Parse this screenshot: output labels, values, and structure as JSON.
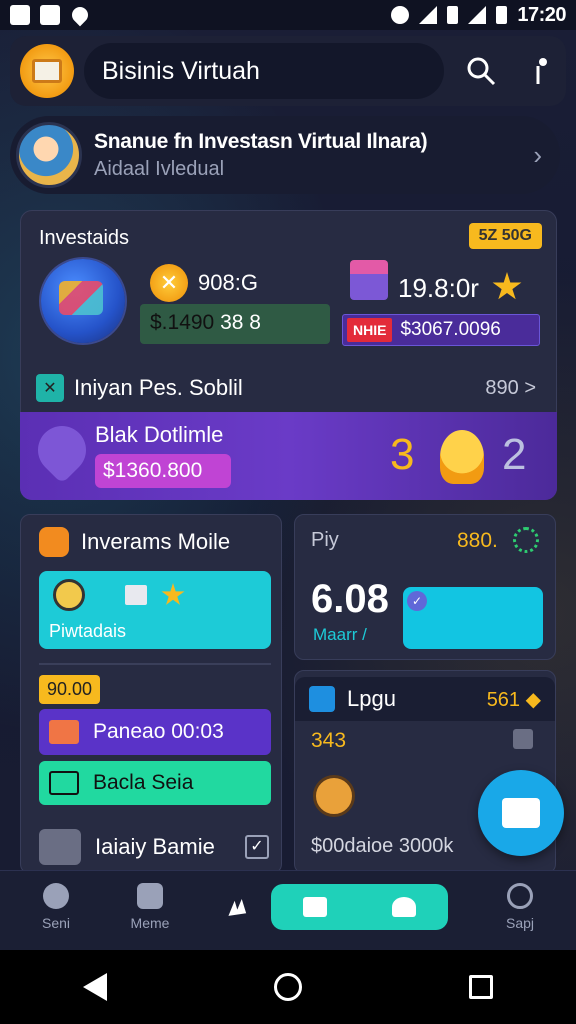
{
  "status": {
    "time": "17:20"
  },
  "header": {
    "title": "Bisinis Virtuah"
  },
  "profile": {
    "name": "Snanue fn Investasn Virtual Ilnara)",
    "subtitle": "Aidaal Ivledual"
  },
  "investments": {
    "title": "Investaids",
    "badge": "5Z 50G",
    "coin_value": "908:G",
    "green_box_prefix": "$.1490",
    "green_box_value": "38 8",
    "right_value": "19.8:0r",
    "tag": "NHIE",
    "purple_value": "$3067.0096"
  },
  "row": {
    "label": "Iniyan Pes. Soblil",
    "value": "890 >"
  },
  "promo": {
    "title": "Blak Dotlimle",
    "amount": "$1360.800",
    "left_num": "3",
    "right_num": "2"
  },
  "left_card": {
    "title": "Inverams Moile",
    "teal_label": "Piwtadais",
    "yellow_tag": "90.00",
    "purple_btn": "Paneao 00:03",
    "green_btn": "Bacla Seia",
    "bottom_label": "Iaiaiy Bamie"
  },
  "right_card": {
    "title": "Piy",
    "value": "880.",
    "big": "6.08",
    "sub": "Maarr /"
  },
  "right_card2": {
    "title": "Lpgu",
    "value": "561 ◆",
    "num": "343",
    "text": "$00daioe 3000k"
  },
  "nav": {
    "items": [
      {
        "label": "Seni"
      },
      {
        "label": "Meme"
      },
      {
        "label": "Sapj"
      }
    ]
  },
  "colors": {
    "accent_yellow": "#f7b91e",
    "accent_teal": "#1dcbd7",
    "accent_purple": "#5a33c8",
    "fab_blue": "#19a8e8"
  }
}
